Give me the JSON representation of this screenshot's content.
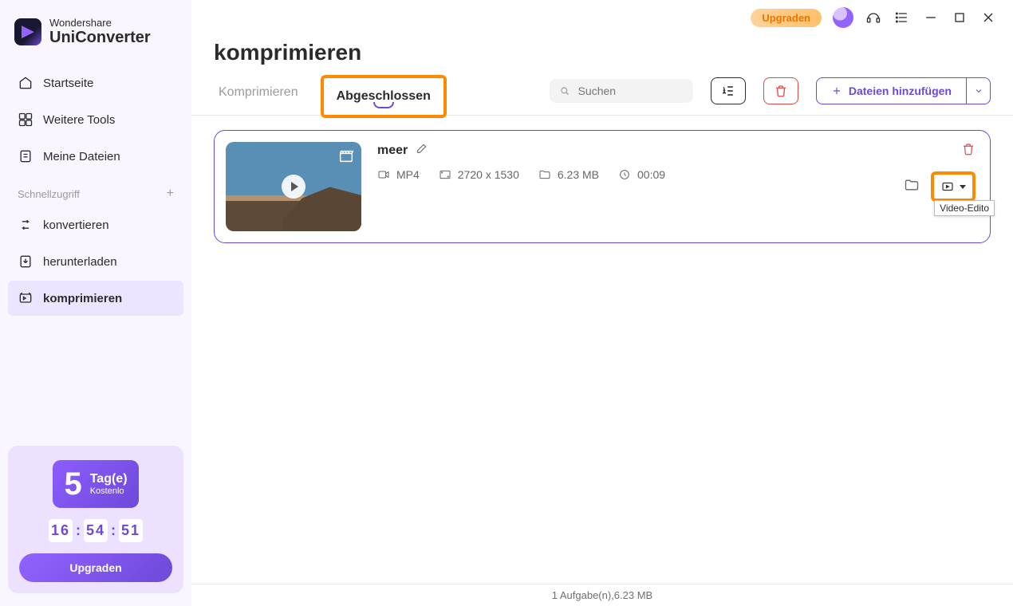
{
  "app": {
    "brand_line1": "Wondershare",
    "brand_line2": "UniConverter"
  },
  "sidebar": {
    "items": {
      "home": {
        "label": "Startseite"
      },
      "tools": {
        "label": "Weitere Tools"
      },
      "files": {
        "label": "Meine Dateien"
      },
      "quick_label": "Schnellzugriff",
      "convert": {
        "label": "konvertieren"
      },
      "download": {
        "label": "herunterladen"
      },
      "compress": {
        "label": "komprimieren"
      }
    },
    "promo": {
      "big_number": "5",
      "days_label": "Tag(e)",
      "sub_label": "Kostenlo",
      "countdown": {
        "h": "16",
        "m": "54",
        "s": "51"
      },
      "button": "Upgraden"
    }
  },
  "titlebar": {
    "upgrade": "Upgraden"
  },
  "page": {
    "title": "komprimieren"
  },
  "tabs": {
    "compress": "Komprimieren",
    "completed": "Abgeschlossen"
  },
  "toolbar": {
    "search_placeholder": "Suchen",
    "add_files": "Dateien hinzufügen"
  },
  "file": {
    "name": "meer",
    "format": "MP4",
    "resolution": "2720 x 1530",
    "size": "6.23 MB",
    "duration": "00:09"
  },
  "tooltip": {
    "video_editor": "Video-Edito"
  },
  "status": {
    "text": "1 Aufgabe(n),6.23 MB"
  }
}
